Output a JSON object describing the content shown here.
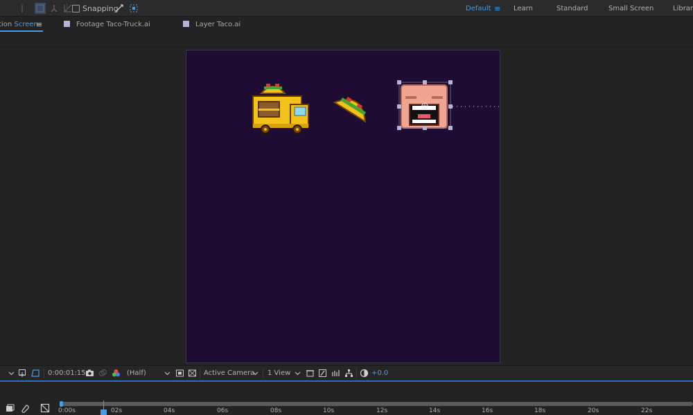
{
  "toolbar": {
    "snapping_label": "Snapping",
    "workspaces": [
      {
        "label": "Default",
        "active": true
      },
      {
        "label": "Learn",
        "active": false
      },
      {
        "label": "Standard",
        "active": false
      },
      {
        "label": "Small Screen",
        "active": false
      },
      {
        "label": "Librari",
        "active": false
      }
    ],
    "menu_icon": "≡"
  },
  "tabs": {
    "composition": {
      "prefix": "tion",
      "name": "Screen"
    },
    "menu_icon": "≡",
    "footage": "Footage Taco-Truck.ai",
    "layer": "Layer Taco.ai",
    "label_color": "#b7b4d6"
  },
  "viewer": {
    "canvas_color": "#1f0c33",
    "timecode": "0:00:01:15",
    "resolution": "(Half)",
    "camera": "Active Camera",
    "views": "1 View",
    "exposure": "+0.0"
  },
  "timeline": {
    "labels": [
      "0:00s",
      "02s",
      "04s",
      "06s",
      "08s",
      "10s",
      "12s",
      "14s",
      "16s",
      "18s",
      "20s",
      "22s"
    ]
  },
  "colors": {
    "accent": "#4a9ce6",
    "panel": "#232323"
  }
}
